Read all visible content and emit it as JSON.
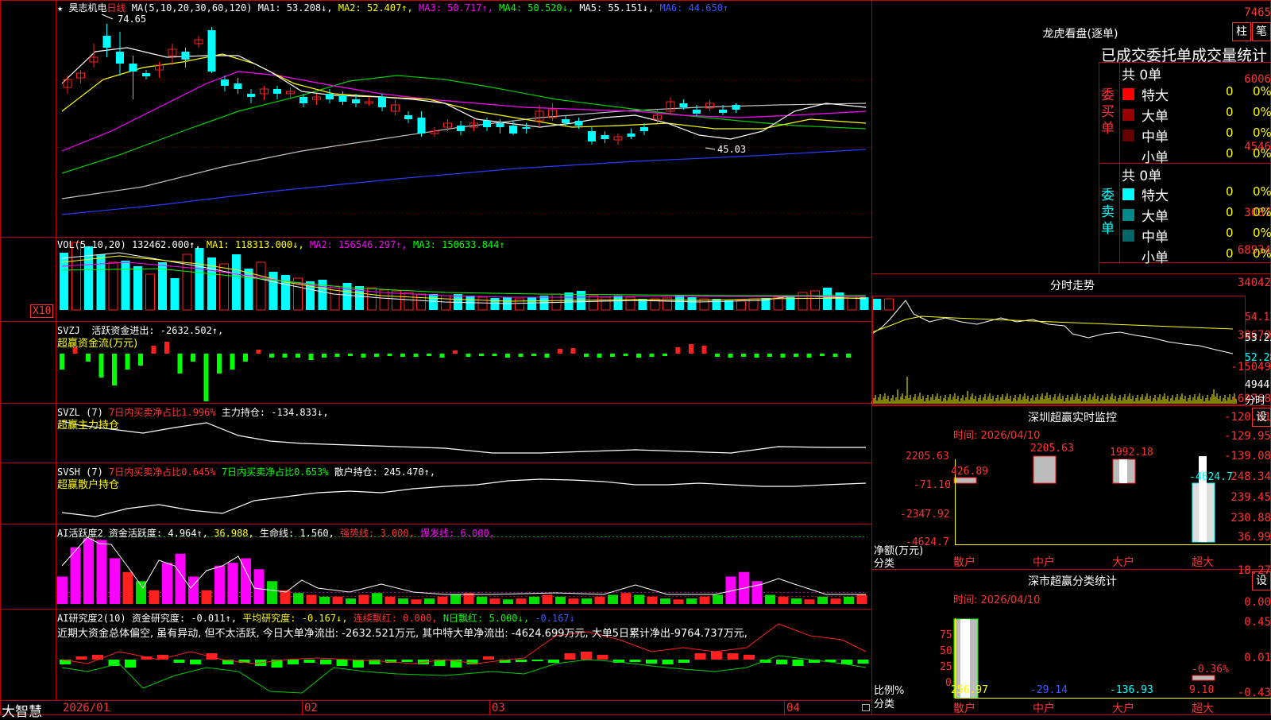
{
  "main": {
    "title_star": "★",
    "stock_name": "昊志机电",
    "period": "日线",
    "ma_prefix": "MA(5,10,20,30,60,120)",
    "ma1": "MA1: 53.208↓,",
    "ma2": "MA2: 52.407↑,",
    "ma3": "MA3: 50.717↑,",
    "ma4": "MA4: 50.520↓,",
    "ma5": "MA5: 55.151↓,",
    "ma6": "MA6: 44.650↑",
    "high_note": "74.65",
    "low_note": "45.03",
    "y_ticks": [
      "7465",
      "6006",
      "4546",
      "3087"
    ]
  },
  "vol": {
    "prefix": "VOL(5,10,20)",
    "value": "132462.000↑,",
    "ma1": "MA1: 118313.000↓,",
    "ma2": "MA2: 156546.297↑,",
    "ma3": "MA3: 150633.844↑",
    "y_ticks": [
      "68934",
      "34042"
    ],
    "unit": "X10"
  },
  "svzj": {
    "prefix": "SVZJ",
    "label": "活跃资金进出: -2632.502↑,",
    "subtitle": "超赢资金流(万元)",
    "y_ticks": [
      "30670",
      "-15049",
      "-60768"
    ]
  },
  "svzl": {
    "prefix": "SVZL (7)",
    "ratio": "7日内买卖净占比1.996%",
    "main_pos": "主力持仓: -134.833↓,",
    "subtitle": "超赢主力持仓",
    "y_ticks": [
      "-120.81",
      "-129.95",
      "-139.08"
    ]
  },
  "svsh": {
    "prefix": "SVSH (7)",
    "ratio1": "7日内买卖净占比0.645%",
    "ratio2": "7日内买卖净占比0.653%",
    "retail": "散户持仓: 245.470↑,",
    "subtitle": "超赢散户持仓",
    "y_ticks": [
      "248.34",
      "239.45",
      "230.88"
    ]
  },
  "ai1": {
    "prefix": "AI活跃度2",
    "activity": "资金活跃度: 4.964↑,",
    "v2": "36.988,",
    "life": "生命线: 1.560,",
    "strong": "强势线: 3.000,",
    "burst": "爆发线: 6.000,",
    "y_ticks": [
      "36.99",
      "18.27",
      "0.00"
    ]
  },
  "ai2": {
    "prefix": "AI研究度2(10)",
    "research": "资金研究度: -0.011↑,",
    "avg": "平均研究度: -0.167↓,",
    "cont": "连续飘红: 0.000,",
    "nday": "N日飘红: 5.000↓,",
    "last": "-0.167↓",
    "comment": "近期大资金总体偏空, 虽有异动, 但不太活跃, 今日大单净流出: -2632.521万元, 其中特大单净流出: -4624.699万元, 大单5日累计净出-9764.737万元,",
    "y_ticks": [
      "0.45",
      "0.01",
      "-0.43"
    ]
  },
  "xaxis": {
    "brand": "大智慧",
    "labels": [
      "2026/01",
      "02",
      "03",
      "04"
    ]
  },
  "right": {
    "dragon_title": "龙虎看盘(逐单)",
    "btn_zhu": "柱",
    "btn_bi": "笔",
    "tabs_line": "已成交委托单成交量统计",
    "buy": {
      "side_label": "委买单",
      "total": "共 0单",
      "rows": [
        {
          "name": "特大",
          "count": "0",
          "pct": "0%",
          "color": "#ff0000"
        },
        {
          "name": "大单",
          "count": "0",
          "pct": "0%",
          "color": "#990000"
        },
        {
          "name": "中单",
          "count": "0",
          "pct": "0%",
          "color": "#660000"
        },
        {
          "name": "小单",
          "count": "0",
          "pct": "0%",
          "color": "#000000"
        }
      ]
    },
    "sell": {
      "side_label": "委卖单",
      "total": "共 0单",
      "rows": [
        {
          "name": "特大",
          "count": "0",
          "pct": "0%",
          "color": "#00ffff"
        },
        {
          "name": "大单",
          "count": "0",
          "pct": "0%",
          "color": "#008888"
        },
        {
          "name": "中单",
          "count": "0",
          "pct": "0%",
          "color": "#006666"
        },
        {
          "name": "小单",
          "count": "0",
          "pct": "0%",
          "color": "#000000"
        }
      ]
    },
    "intraday": {
      "title": "分时走势",
      "y_ticks": [
        "54.17",
        "53.22",
        "52.28"
      ],
      "vol_tick": "4944",
      "vol_label": "分时"
    },
    "sz_monitor": {
      "title": "深圳超赢实时监控",
      "settings": "设",
      "time": "时间: 2026/04/10",
      "y_ticks": [
        "2205.63",
        "-71.10",
        "-2347.92",
        "-4624.7"
      ],
      "ylabel": "净额(万元)",
      "xlabel": "分类",
      "categories": [
        "散户",
        "中户",
        "大户",
        "超大"
      ],
      "values": [
        "426.89",
        "2205.63",
        "1992.18",
        "-4624.7"
      ]
    },
    "sz_class": {
      "title": "深市超赢分类统计",
      "settings": "设",
      "time": "时间: 2026/04/10",
      "y_ticks": [
        "75",
        "50",
        "25",
        "0"
      ],
      "ylabel": "比例%",
      "xlabel": "分类",
      "categories": [
        "散户",
        "中户",
        "大户",
        "超大"
      ],
      "values": [
        "256.97",
        "-29.14",
        "-136.93",
        "9.10"
      ],
      "top_note": "-0.36%"
    }
  }
}
